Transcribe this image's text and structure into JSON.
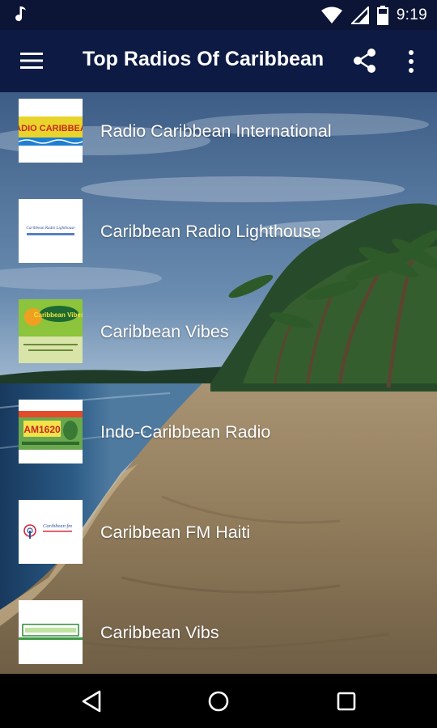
{
  "status_bar": {
    "time": "9:19",
    "icons": [
      "music-note-icon",
      "wifi-icon",
      "cell-signal-icon",
      "battery-icon"
    ]
  },
  "app_bar": {
    "title": "Top Radios Of Caribbean",
    "icons": [
      "hamburger-menu-icon",
      "share-icon",
      "more-vert-icon"
    ]
  },
  "stations": [
    {
      "name": "Radio Caribbean International",
      "logo_text": "RADIO CARIBBEAN"
    },
    {
      "name": "Caribbean Radio Lighthouse",
      "logo_text": "Caribbean Radio Lighthouse"
    },
    {
      "name": "Caribbean Vibes",
      "logo_text": "Caribbean Vibes"
    },
    {
      "name": "Indo-Caribbean Radio",
      "logo_text": "AM1620"
    },
    {
      "name": "Caribbean FM Haiti",
      "logo_text": "Caribbean fm"
    },
    {
      "name": "Caribbean Vibs",
      "logo_text": ""
    }
  ],
  "nav_bar": {
    "icons": [
      "back-triangle-icon",
      "home-circle-icon",
      "recents-square-icon"
    ]
  },
  "colors": {
    "app_bar": "#0d1a43",
    "status_bar": "#0c1535",
    "nav_bar": "#000000",
    "text": "#ffffff"
  }
}
